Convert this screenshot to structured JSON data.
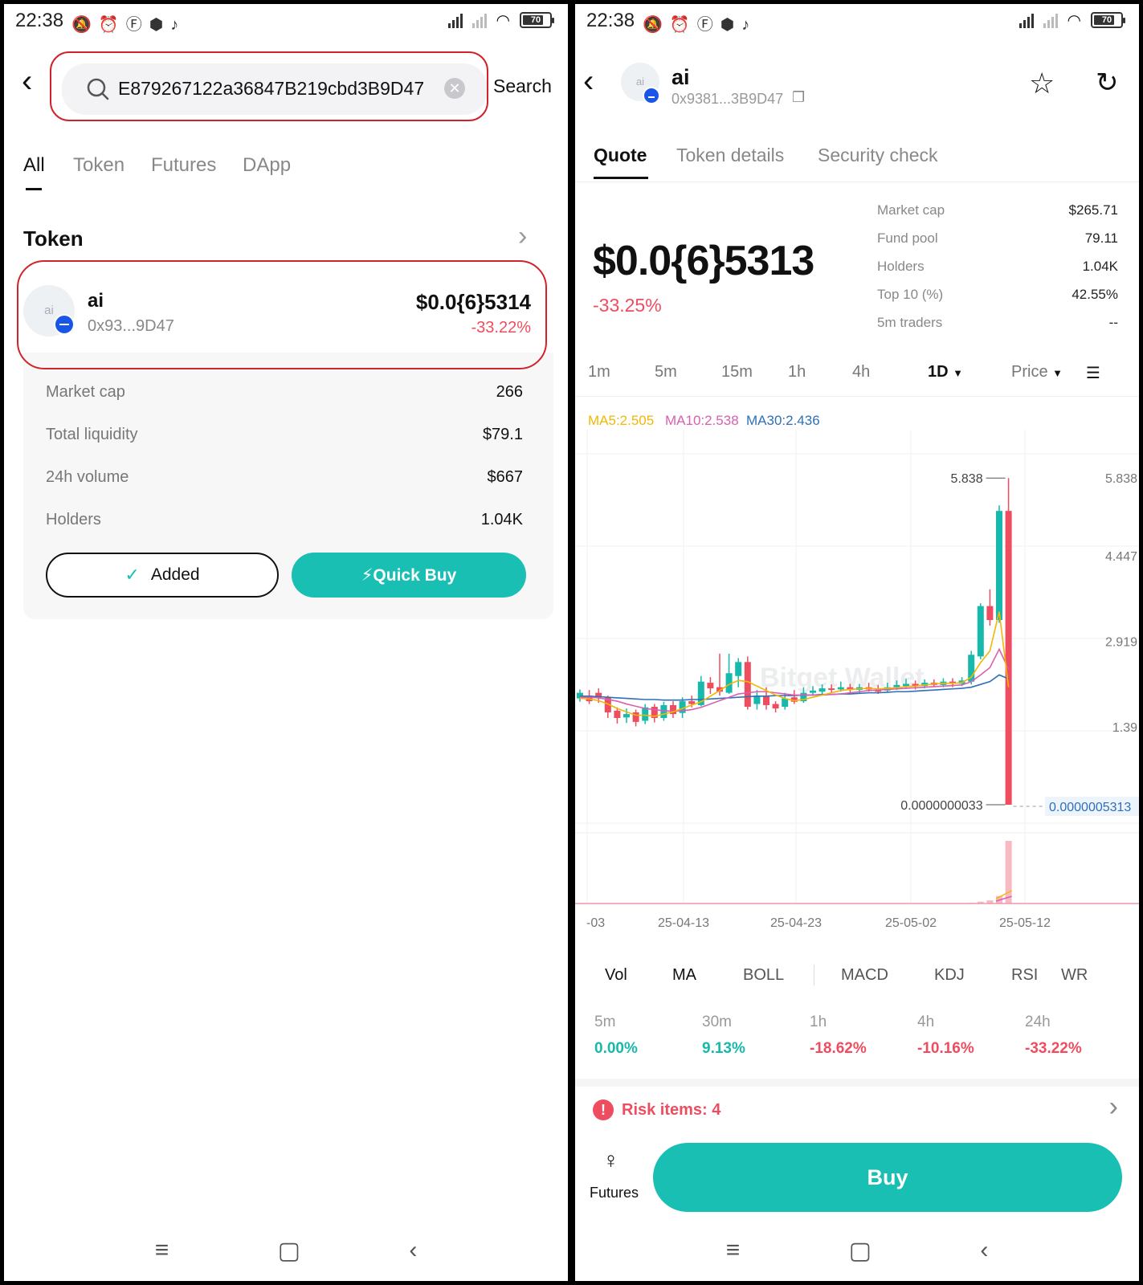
{
  "status_bar": {
    "time": "22:38",
    "battery": "70"
  },
  "left": {
    "search": {
      "value": "E879267122a36847B219cbd3B9D47",
      "submit_label": "Search"
    },
    "tabs": [
      "All",
      "Token",
      "Futures",
      "DApp"
    ],
    "section_title": "Token",
    "token": {
      "avatar_text": "ai",
      "name": "ai",
      "address": "0x93...9D47",
      "price": "$0.0{6}5314",
      "change": "-33.22%"
    },
    "stats": [
      {
        "label": "Market cap",
        "value": "266"
      },
      {
        "label": "Total liquidity",
        "value": "$79.1"
      },
      {
        "label": "24h volume",
        "value": "$667"
      },
      {
        "label": "Holders",
        "value": "1.04K"
      }
    ],
    "added_label": "Added",
    "quick_buy_label": "⚡Quick Buy"
  },
  "right": {
    "header": {
      "avatar_text": "ai",
      "name": "ai",
      "address": "0x9381...3B9D47"
    },
    "tabs": [
      "Quote",
      "Token details",
      "Security check"
    ],
    "price": "$0.0{6}5313",
    "change": "-33.25%",
    "stats": [
      {
        "label": "Market cap",
        "value": "$265.71"
      },
      {
        "label": "Fund pool",
        "value": "79.11"
      },
      {
        "label": "Holders",
        "value": "1.04K"
      },
      {
        "label": "Top 10 (%)",
        "value": "42.55%"
      },
      {
        "label": "5m traders",
        "value": "--"
      }
    ],
    "timeframes": [
      "1m",
      "5m",
      "15m",
      "1h",
      "4h",
      "1D",
      "Price"
    ],
    "ma_legend": {
      "ma5": "MA5:2.505",
      "ma10": "MA10:2.538",
      "ma30": "MA30:2.436"
    },
    "indicators": [
      "Vol",
      "MA",
      "BOLL",
      "MACD",
      "KDJ",
      "RSI",
      "WR"
    ],
    "changes": [
      {
        "label": "5m",
        "value": "0.00%"
      },
      {
        "label": "30m",
        "value": "9.13%"
      },
      {
        "label": "1h",
        "value": "-18.62%"
      },
      {
        "label": "4h",
        "value": "-10.16%"
      },
      {
        "label": "24h",
        "value": "-33.22%"
      }
    ],
    "risk_label": "Risk items: 4",
    "futures_label": "Futures",
    "buy_label": "Buy",
    "watermark": "Bitget Wallet"
  },
  "colors": {
    "accent": "#19bfb3",
    "up": "#18b9ad",
    "down": "#ee4d5f",
    "highlight_ring": "#d0232b"
  },
  "chart_data": {
    "type": "candlestick",
    "y_ticks": [
      "5.838",
      "4.447",
      "2.919",
      "1.39"
    ],
    "high_label": "5.838",
    "low_label": "0.0000000033",
    "last_label": "0.0000005313",
    "x_labels": [
      "-03",
      "25-04-13",
      "25-04-23",
      "25-05-02",
      "25-05-12"
    ],
    "ylim": [
      0,
      6.3
    ],
    "candles": [
      {
        "o": 1.9,
        "c": 2.0,
        "h": 2.06,
        "l": 1.84
      },
      {
        "o": 1.95,
        "c": 1.85,
        "h": 2.05,
        "l": 1.8
      },
      {
        "o": 2.0,
        "c": 1.92,
        "h": 2.08,
        "l": 1.82
      },
      {
        "o": 1.92,
        "c": 1.65,
        "h": 1.95,
        "l": 1.55
      },
      {
        "o": 1.68,
        "c": 1.55,
        "h": 1.74,
        "l": 1.45
      },
      {
        "o": 1.56,
        "c": 1.62,
        "h": 1.72,
        "l": 1.46
      },
      {
        "o": 1.65,
        "c": 1.48,
        "h": 1.7,
        "l": 1.4
      },
      {
        "o": 1.5,
        "c": 1.74,
        "h": 1.8,
        "l": 1.44
      },
      {
        "o": 1.75,
        "c": 1.55,
        "h": 1.8,
        "l": 1.47
      },
      {
        "o": 1.55,
        "c": 1.78,
        "h": 1.84,
        "l": 1.5
      },
      {
        "o": 1.78,
        "c": 1.62,
        "h": 1.85,
        "l": 1.55
      },
      {
        "o": 1.64,
        "c": 1.85,
        "h": 1.92,
        "l": 1.55
      },
      {
        "o": 1.85,
        "c": 1.8,
        "h": 1.95,
        "l": 1.74
      },
      {
        "o": 1.78,
        "c": 2.2,
        "h": 2.3,
        "l": 1.76
      },
      {
        "o": 2.18,
        "c": 2.08,
        "h": 2.28,
        "l": 1.98
      },
      {
        "o": 2.1,
        "c": 2.02,
        "h": 2.7,
        "l": 1.95
      },
      {
        "o": 2.0,
        "c": 2.35,
        "h": 2.7,
        "l": 1.98
      },
      {
        "o": 2.3,
        "c": 2.55,
        "h": 2.62,
        "l": 2.1
      },
      {
        "o": 2.55,
        "c": 1.75,
        "h": 2.65,
        "l": 1.7
      },
      {
        "o": 1.8,
        "c": 1.95,
        "h": 2.05,
        "l": 1.7
      },
      {
        "o": 1.95,
        "c": 1.78,
        "h": 2.1,
        "l": 1.7
      },
      {
        "o": 1.8,
        "c": 1.72,
        "h": 1.85,
        "l": 1.65
      },
      {
        "o": 1.75,
        "c": 1.9,
        "h": 2.0,
        "l": 1.7
      },
      {
        "o": 1.92,
        "c": 1.84,
        "h": 2.05,
        "l": 1.8
      },
      {
        "o": 1.85,
        "c": 2.0,
        "h": 2.1,
        "l": 1.82
      },
      {
        "o": 2.0,
        "c": 2.04,
        "h": 2.12,
        "l": 1.95
      },
      {
        "o": 2.02,
        "c": 2.08,
        "h": 2.15,
        "l": 1.97
      },
      {
        "o": 2.08,
        "c": 2.06,
        "h": 2.15,
        "l": 2.0
      },
      {
        "o": 2.06,
        "c": 2.1,
        "h": 2.2,
        "l": 2.02
      },
      {
        "o": 2.1,
        "c": 2.05,
        "h": 2.16,
        "l": 2.0
      },
      {
        "o": 2.05,
        "c": 2.1,
        "h": 2.16,
        "l": 2.0
      },
      {
        "o": 2.1,
        "c": 2.06,
        "h": 2.18,
        "l": 2.02
      },
      {
        "o": 2.06,
        "c": 2.02,
        "h": 2.14,
        "l": 1.98
      },
      {
        "o": 2.04,
        "c": 2.1,
        "h": 2.18,
        "l": 2.0
      },
      {
        "o": 2.1,
        "c": 2.14,
        "h": 2.22,
        "l": 2.05
      },
      {
        "o": 2.12,
        "c": 2.16,
        "h": 2.25,
        "l": 2.07
      },
      {
        "o": 2.16,
        "c": 2.12,
        "h": 2.22,
        "l": 2.06
      },
      {
        "o": 2.12,
        "c": 2.18,
        "h": 2.24,
        "l": 2.08
      },
      {
        "o": 2.18,
        "c": 2.14,
        "h": 2.24,
        "l": 2.1
      },
      {
        "o": 2.14,
        "c": 2.2,
        "h": 2.26,
        "l": 2.1
      },
      {
        "o": 2.2,
        "c": 2.16,
        "h": 2.26,
        "l": 2.1
      },
      {
        "o": 2.16,
        "c": 2.22,
        "h": 2.28,
        "l": 2.12
      },
      {
        "o": 2.2,
        "c": 2.68,
        "h": 2.75,
        "l": 2.15
      },
      {
        "o": 2.65,
        "c": 3.55,
        "h": 3.6,
        "l": 2.6
      },
      {
        "o": 3.55,
        "c": 3.3,
        "h": 3.85,
        "l": 3.2
      },
      {
        "o": 3.3,
        "c": 5.25,
        "h": 5.35,
        "l": 3.25
      },
      {
        "o": 5.25,
        "c": 0.0,
        "h": 5.838,
        "l": 0.0
      }
    ],
    "ma5": [
      1.9,
      1.89,
      1.86,
      1.8,
      1.72,
      1.66,
      1.6,
      1.6,
      1.58,
      1.62,
      1.66,
      1.72,
      1.78,
      1.84,
      1.94,
      2.04,
      2.15,
      2.22,
      2.2,
      2.12,
      2.04,
      1.96,
      1.9,
      1.86,
      1.88,
      1.92,
      1.96,
      2.0,
      2.04,
      2.06,
      2.07,
      2.08,
      2.07,
      2.08,
      2.09,
      2.11,
      2.12,
      2.14,
      2.16,
      2.17,
      2.17,
      2.18,
      2.28,
      2.54,
      2.75,
      3.45,
      2.1
    ],
    "ma10": [
      1.92,
      1.92,
      1.91,
      1.88,
      1.85,
      1.8,
      1.76,
      1.72,
      1.7,
      1.68,
      1.67,
      1.68,
      1.7,
      1.74,
      1.8,
      1.86,
      1.92,
      1.98,
      2.0,
      2.02,
      2.02,
      2.0,
      1.98,
      1.96,
      1.96,
      1.96,
      1.96,
      1.97,
      1.98,
      2.0,
      2.02,
      2.04,
      2.05,
      2.06,
      2.07,
      2.08,
      2.09,
      2.1,
      2.11,
      2.12,
      2.13,
      2.14,
      2.2,
      2.32,
      2.45,
      2.78,
      2.42
    ],
    "ma30": [
      1.94,
      1.94,
      1.93,
      1.92,
      1.91,
      1.9,
      1.89,
      1.88,
      1.88,
      1.87,
      1.87,
      1.87,
      1.88,
      1.88,
      1.89,
      1.9,
      1.91,
      1.92,
      1.93,
      1.94,
      1.94,
      1.95,
      1.95,
      1.95,
      1.96,
      1.96,
      1.97,
      1.97,
      1.98,
      1.98,
      1.99,
      2.0,
      2.0,
      2.01,
      2.02,
      2.02,
      2.03,
      2.04,
      2.05,
      2.06,
      2.07,
      2.08,
      2.1,
      2.15,
      2.2,
      2.32,
      2.25
    ],
    "volume": [
      0,
      0,
      0,
      0,
      0,
      0,
      0,
      0,
      0,
      0,
      0,
      0,
      0,
      0,
      0,
      0,
      0,
      0,
      0,
      0,
      0,
      0,
      0,
      0,
      0,
      0,
      0,
      0,
      0,
      0,
      0,
      0,
      0,
      0,
      0,
      0,
      0,
      0,
      0,
      0,
      0,
      0,
      0.01,
      0.03,
      0.05,
      0.12,
      1.0
    ]
  }
}
